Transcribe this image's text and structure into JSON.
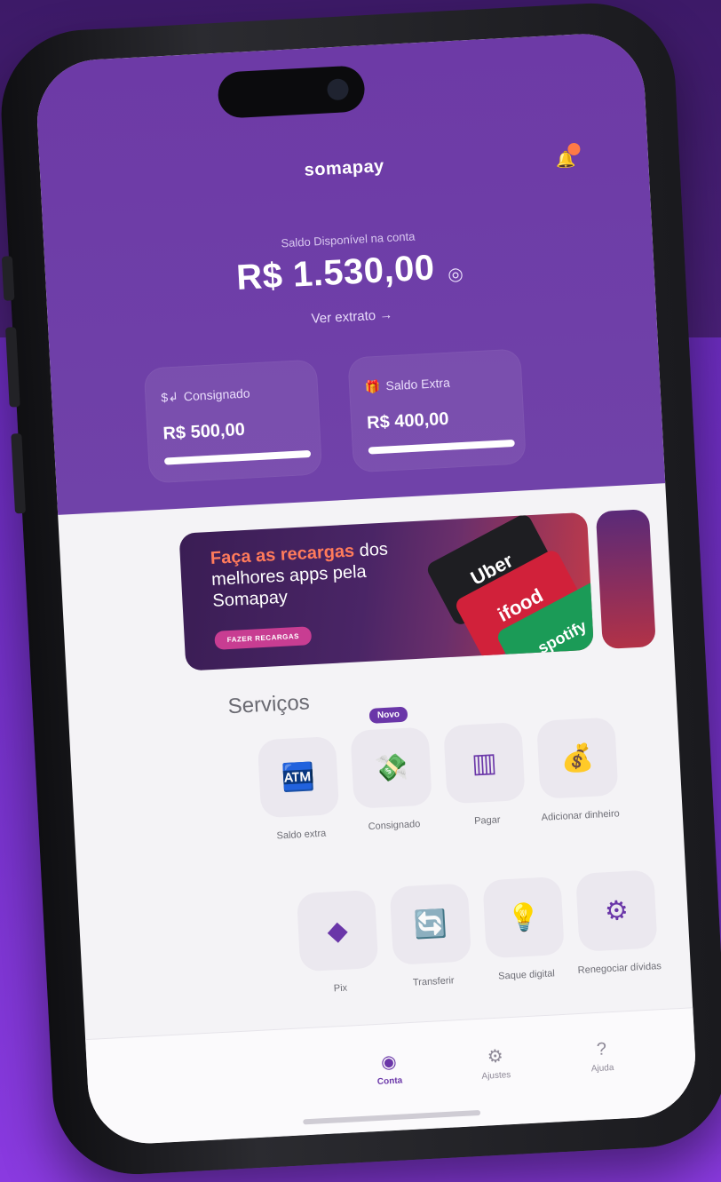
{
  "app": {
    "brand": "somapay"
  },
  "balance": {
    "label": "Saldo Disponível na conta",
    "value": "R$ 1.530,00",
    "extrato_link": "Ver extrato →"
  },
  "cards": [
    {
      "title": "Consignado",
      "value": "R$ 500,00",
      "icon": "money-transfer-icon",
      "progress": 1.0
    },
    {
      "title": "Saldo Extra",
      "value": "R$ 400,00",
      "icon": "gift-icon",
      "progress": 1.0
    }
  ],
  "banner": {
    "highlight": "Faça as recargas",
    "rest": " dos melhores apps pela Somapay",
    "button": "FAZER RECARGAS",
    "card1": "Uber",
    "card2": "ifood",
    "card3": "spotify"
  },
  "services": {
    "title": "Serviços",
    "items": [
      {
        "label": "Saldo extra",
        "icon": "atm-cash-icon",
        "glyph": "🏧"
      },
      {
        "label": "Consignado",
        "icon": "hand-money-icon",
        "glyph": "💸",
        "badge": "Novo"
      },
      {
        "label": "Pagar",
        "icon": "barcode-scan-icon",
        "glyph": "▥"
      },
      {
        "label": "Adicionar dinheiro",
        "icon": "deposit-icon",
        "glyph": "💰"
      },
      {
        "label": "Pix",
        "icon": "pix-icon",
        "glyph": "◆"
      },
      {
        "label": "Transferir",
        "icon": "transfer-icon",
        "glyph": "🔄"
      },
      {
        "label": "Saque digital",
        "icon": "lightbulb-money-icon",
        "glyph": "💡"
      },
      {
        "label": "Renegociar dívidas",
        "icon": "gear-money-icon",
        "glyph": "⚙"
      }
    ]
  },
  "nav": [
    {
      "label": "Conta",
      "icon": "user-circle-icon",
      "glyph": "◉"
    },
    {
      "label": "Ajustes",
      "icon": "settings-icon",
      "glyph": "⚙"
    },
    {
      "label": "Ajuda",
      "icon": "help-icon",
      "glyph": "?"
    }
  ],
  "colors": {
    "brand_purple": "#6a36a8",
    "header_purple": "#7042a9",
    "accent_orange": "#ff7b5b",
    "banner_button": "#c83d92"
  }
}
